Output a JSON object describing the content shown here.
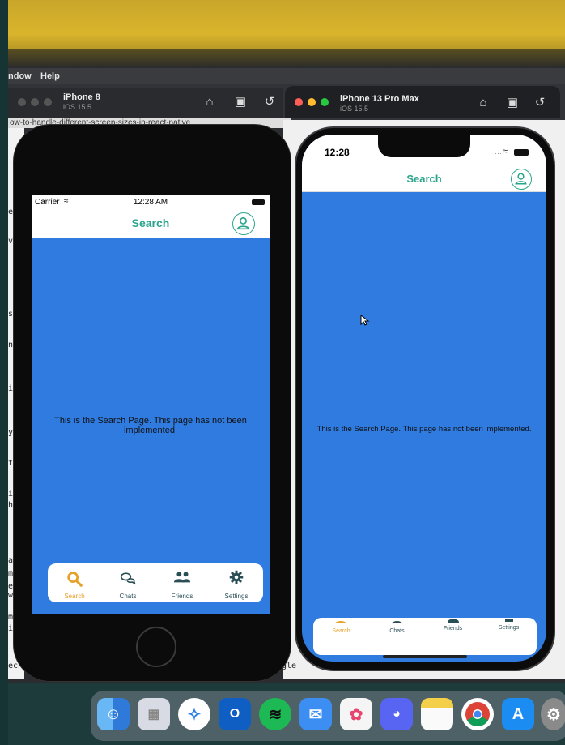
{
  "menubar": {
    "items": [
      "ndow",
      "Help"
    ]
  },
  "browser": {
    "url_fragment": "ow-to-handle-different-screen-sizes-in-react-native"
  },
  "code_fragments": [
    "e",
    "ve",
    "s",
    "ns",
    "ig",
    "yl",
    "ti",
    "idt",
    "hei",
    "ar",
    "me",
    "e, w",
    "men",
    "ime",
    "echn"
  ],
  "right_code_fragment": "gle",
  "simulators": [
    {
      "name": "iPhone 8",
      "os": "iOS 15.5"
    },
    {
      "name": "iPhone 13 Pro Max",
      "os": "iOS 15.5"
    }
  ],
  "phone1": {
    "carrier": "Carrier",
    "time": "12:28 AM",
    "title": "Search",
    "message": "This is the Search Page. This page has not been implemented.",
    "tabs": [
      {
        "label": "Search",
        "icon": "magnifier-icon",
        "active": true
      },
      {
        "label": "Chats",
        "icon": "chat-bubbles-icon",
        "active": false
      },
      {
        "label": "Friends",
        "icon": "people-icon",
        "active": false
      },
      {
        "label": "Settings",
        "icon": "gear-icon",
        "active": false
      }
    ]
  },
  "phone2": {
    "time": "12:28",
    "title": "Search",
    "message": "This is the Search Page. This page has not been implemented.",
    "tabs": [
      {
        "label": "Search",
        "active": true
      },
      {
        "label": "Chats",
        "active": false
      },
      {
        "label": "Friends",
        "active": false
      },
      {
        "label": "Settings",
        "active": false
      }
    ]
  },
  "colors": {
    "screen_bg": "#2f7be0",
    "accent_teal": "#2aa58c",
    "active_tab": "#e6a12a",
    "tab_text": "#2a4e56"
  },
  "dock": {
    "apps": [
      "finder-icon",
      "launchpad-icon",
      "safari-icon",
      "outlook-icon",
      "spotify-icon",
      "mail-icon",
      "photos-icon",
      "discord-icon",
      "notes-icon",
      "chrome-icon",
      "app-store-icon",
      "system-preferences-icon"
    ]
  }
}
